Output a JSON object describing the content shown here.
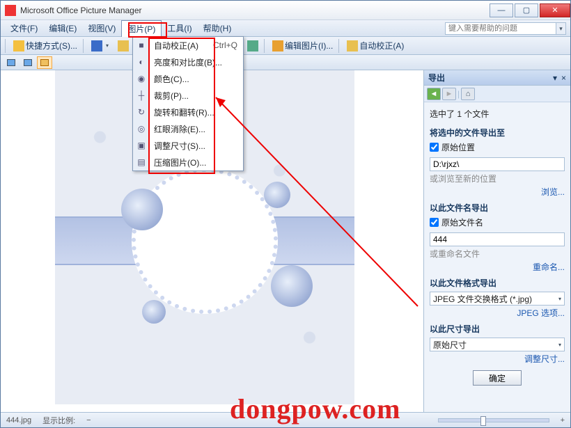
{
  "title": "Microsoft Office Picture Manager",
  "menu": {
    "file": "文件(F)",
    "edit": "编辑(E)",
    "view": "视图(V)",
    "picture": "图片(P)",
    "tools": "工具(I)",
    "help": "帮助(H)",
    "help_placeholder": "键入需要帮助的问题"
  },
  "toolbar": {
    "shortcut": "快捷方式(S)...",
    "zoom_pct": "%",
    "edit_pic": "编辑图片(I)...",
    "auto_correct": "自动校正(A)"
  },
  "dropdown": {
    "items": [
      {
        "label": "自动校正(A)",
        "shortcut": "Ctrl+Q",
        "icon": "■"
      },
      {
        "label": "亮度和对比度(B)...",
        "icon": "◐"
      },
      {
        "label": "颜色(C)...",
        "icon": "◉"
      },
      {
        "label": "裁剪(P)...",
        "icon": "┼"
      },
      {
        "label": "旋转和翻转(R)...",
        "icon": "↻"
      },
      {
        "label": "红眼消除(E)...",
        "icon": "◎"
      },
      {
        "label": "调整尺寸(S)...",
        "icon": "▣"
      },
      {
        "label": "压缩图片(O)...",
        "icon": "▤"
      }
    ]
  },
  "side": {
    "title": "导出",
    "selected": "选中了 1 个文件",
    "export_to": "将选中的文件导出至",
    "orig_loc": "原始位置",
    "path": "D:\\rjxz\\",
    "browse_new": "或浏览至新的位置",
    "browse_link": "浏览...",
    "name_sec": "以此文件名导出",
    "orig_name": "原始文件名",
    "name_val": "444",
    "rename": "或重命名文件",
    "rename_link": "重命名...",
    "fmt_sec": "以此文件格式导出",
    "fmt_val": "JPEG 文件交换格式 (*.jpg)",
    "jpeg_opts": "JPEG 选项...",
    "size_sec": "以此尺寸导出",
    "size_val": "原始尺寸",
    "resize_link": "调整尺寸...",
    "ok": "确定"
  },
  "status": {
    "filename": "444.jpg",
    "zoom_label": "显示比例:"
  },
  "watermark": "dongpow.com"
}
